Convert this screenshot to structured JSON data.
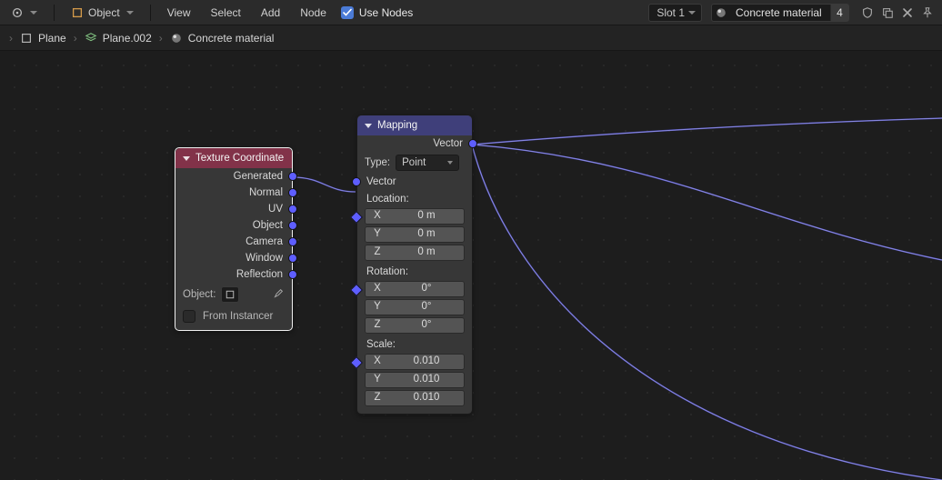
{
  "header": {
    "mode_label": "Object",
    "menus": [
      "View",
      "Select",
      "Add",
      "Node"
    ],
    "use_nodes_label": "Use Nodes",
    "use_nodes_checked": true,
    "slot_label": "Slot 1",
    "material_name": "Concrete material",
    "material_users": "4"
  },
  "breadcrumb": {
    "items": [
      "Plane",
      "Plane.002",
      "Concrete material"
    ]
  },
  "nodes": {
    "texcoord": {
      "title": "Texture Coordinate",
      "outputs": [
        "Generated",
        "Normal",
        "UV",
        "Object",
        "Camera",
        "Window",
        "Reflection"
      ],
      "object_label": "Object:",
      "from_instancer_label": "From Instancer"
    },
    "mapping": {
      "title": "Mapping",
      "output": "Vector",
      "type_label": "Type:",
      "type_value": "Point",
      "vector_in": "Vector",
      "groups": {
        "location": {
          "label": "Location:",
          "x": "0 m",
          "y": "0 m",
          "z": "0 m"
        },
        "rotation": {
          "label": "Rotation:",
          "x": "0°",
          "y": "0°",
          "z": "0°"
        },
        "scale": {
          "label": "Scale:",
          "x": "0.010",
          "y": "0.010",
          "z": "0.010"
        }
      }
    }
  }
}
